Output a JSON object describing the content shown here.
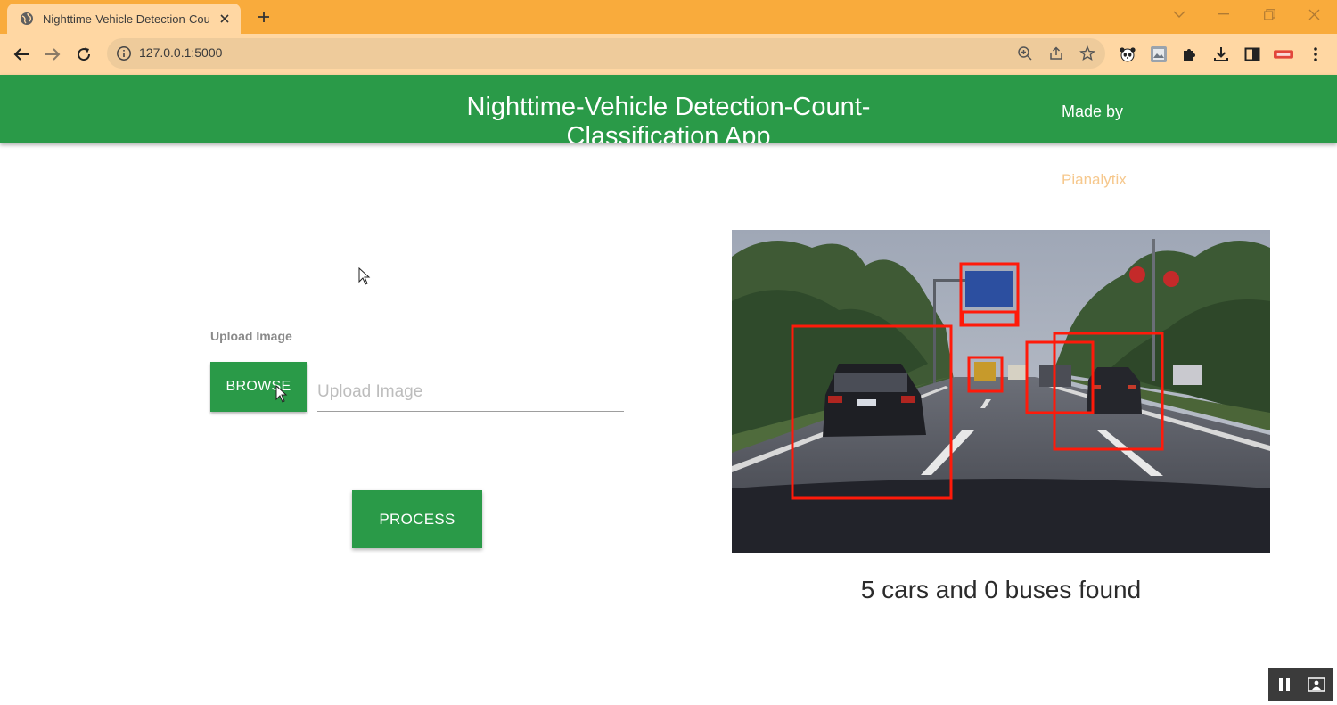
{
  "browser": {
    "tab_title": "Nighttime-Vehicle Detection-Cou",
    "url": "127.0.0.1:5000"
  },
  "app": {
    "title": "Nighttime-Vehicle Detection-Count-Classification App",
    "made_by_label": "Made by",
    "brand": "Pianalytix"
  },
  "form": {
    "upload_label": "Upload Image",
    "browse_label": "BROWSE",
    "input_placeholder": "Upload Image",
    "process_label": "PROCESS"
  },
  "result": {
    "summary": "5 cars and 0 buses found",
    "detections_count": 6
  },
  "colors": {
    "accent_green": "#2a9a48",
    "browser_orange": "#f9ab3c",
    "brand_text": "#f6c88d",
    "detection_box": "#ff1a0a"
  }
}
